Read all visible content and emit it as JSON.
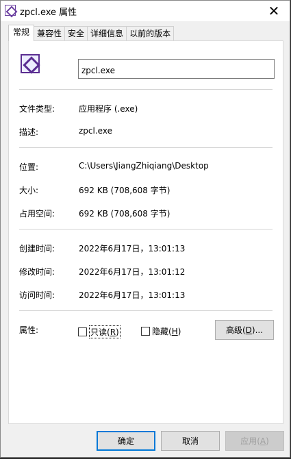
{
  "window": {
    "title": "zpcl.exe 属性"
  },
  "tabs": [
    "常规",
    "兼容性",
    "安全",
    "详细信息",
    "以前的版本"
  ],
  "file": {
    "name": "zpcl.exe"
  },
  "info": {
    "type_label": "文件类型:",
    "type_value": "应用程序 (.exe)",
    "desc_label": "描述:",
    "desc_value": "zpcl.exe",
    "loc_label": "位置:",
    "loc_value": "C:\\Users\\JiangZhiqiang\\Desktop",
    "size_label": "大小:",
    "size_value": "692 KB (708,608 字节)",
    "disk_label": "占用空间:",
    "disk_value": "692 KB (708,608 字节)",
    "created_label": "创建时间:",
    "created_value": "2022年6月17日，13:01:13",
    "modified_label": "修改时间:",
    "modified_value": "2022年6月17日，13:01:12",
    "accessed_label": "访问时间:",
    "accessed_value": "2022年6月17日，13:01:13"
  },
  "attributes": {
    "label": "属性:",
    "readonly_text": "只读(",
    "readonly_key": "R",
    "readonly_close": ")",
    "hidden_text": "隐藏(",
    "hidden_key": "H",
    "hidden_close": ")",
    "advanced_text": "高级(",
    "advanced_key": "D",
    "advanced_close": ")..."
  },
  "buttons": {
    "ok": "确定",
    "cancel": "取消",
    "apply_text": "应用(",
    "apply_key": "A",
    "apply_close": ")"
  }
}
